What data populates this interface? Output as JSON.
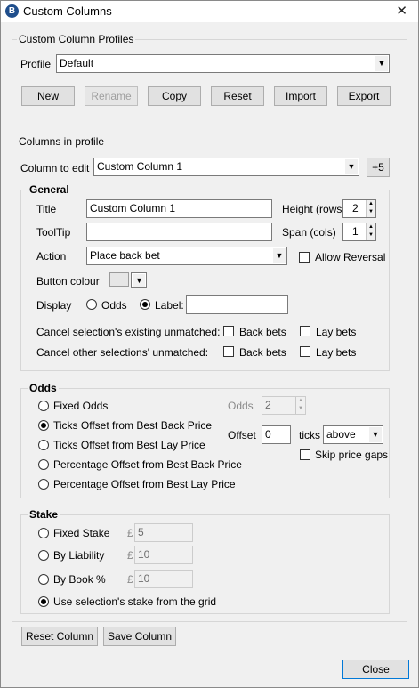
{
  "window": {
    "title": "Custom Columns",
    "icon_letter": "B",
    "close_glyph": "✕"
  },
  "profiles": {
    "group_label": "Custom Column Profiles",
    "profile_label": "Profile",
    "profile_value": "Default",
    "buttons": {
      "new": "New",
      "rename": "Rename",
      "copy": "Copy",
      "reset": "Reset",
      "import": "Import",
      "export": "Export"
    }
  },
  "columns": {
    "group_label": "Columns in profile",
    "column_to_edit_label": "Column to edit",
    "column_to_edit_value": "Custom Column 1",
    "plus5_label": "+5"
  },
  "general": {
    "group_label": "General",
    "title_label": "Title",
    "title_value": "Custom Column 1",
    "height_label": "Height (rows)",
    "height_value": "2",
    "tooltip_label": "ToolTip",
    "tooltip_value": "",
    "span_label": "Span (cols)",
    "span_value": "1",
    "action_label": "Action",
    "action_value": "Place back bet",
    "allow_reversal_label": "Allow Reversal",
    "allow_reversal_checked": false,
    "button_colour_label": "Button colour",
    "display_label": "Display",
    "display_odds_label": "Odds",
    "display_label_option": "Label:",
    "display_selected": "Label",
    "label_value": "",
    "cancel_existing_label": "Cancel selection's existing unmatched:",
    "cancel_other_label": "Cancel other selections' unmatched:",
    "back_bets_label": "Back bets",
    "lay_bets_label": "Lay bets"
  },
  "odds": {
    "group_label": "Odds",
    "options": [
      "Fixed Odds",
      "Ticks Offset from Best Back Price",
      "Ticks Offset from Best Lay Price",
      "Percentage Offset from Best Back Price",
      "Percentage Offset from Best Lay Price"
    ],
    "selected_index": 1,
    "odds_label": "Odds",
    "odds_value": "2",
    "offset_label": "Offset",
    "offset_value": "0",
    "ticks_label": "ticks",
    "direction_value": "above",
    "skip_gaps_label": "Skip price gaps",
    "skip_gaps_checked": false
  },
  "stake": {
    "group_label": "Stake",
    "fixed_label": "Fixed Stake",
    "fixed_value": "5",
    "liability_label": "By Liability",
    "liability_value": "10",
    "book_label": "By Book %",
    "book_value": "10",
    "currency_symbol": "£",
    "use_grid_label": "Use selection's stake from the grid",
    "selected": "use_grid"
  },
  "footer": {
    "reset_column": "Reset Column",
    "save_column": "Save Column",
    "close": "Close"
  },
  "icons": {
    "dropdown_arrow": "▼",
    "spin_up": "▲",
    "spin_down": "▼"
  }
}
